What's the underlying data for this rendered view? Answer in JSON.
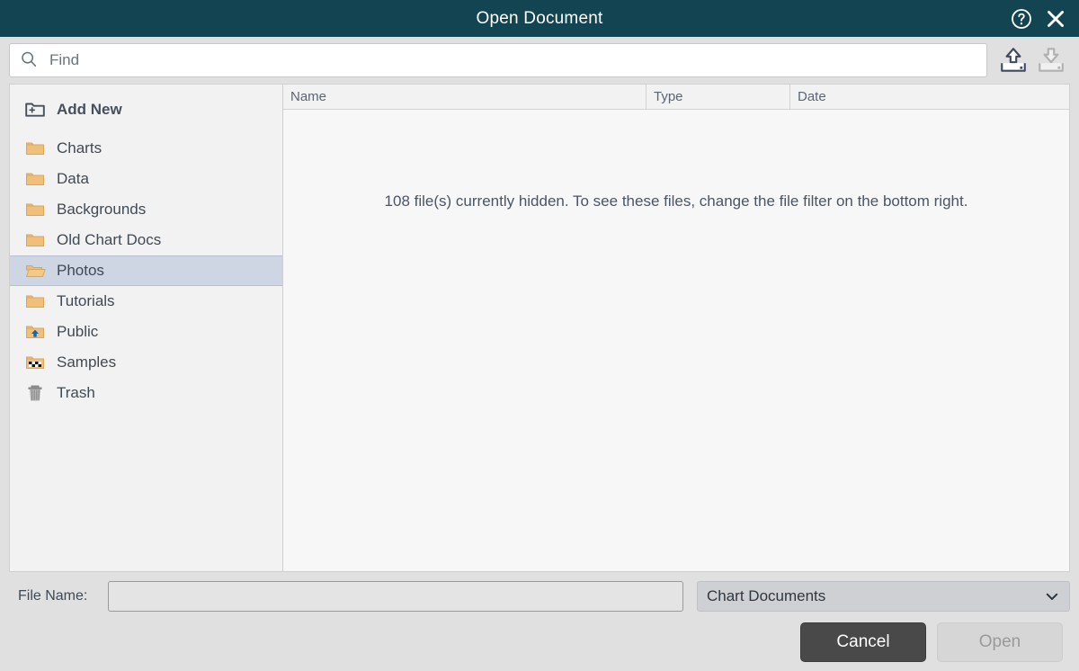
{
  "window": {
    "title": "Open Document",
    "help_icon": "help-circle-icon",
    "close_icon": "close-icon",
    "titlebar_color": "#124451"
  },
  "search": {
    "placeholder": "Find",
    "value": "",
    "icon": "search-icon",
    "upload_icon": "upload-tray-icon",
    "download_icon": "download-tray-icon"
  },
  "sidebar": {
    "add_new": {
      "label": "Add New",
      "icon": "folder-plus-icon"
    },
    "items": [
      {
        "label": "Charts",
        "icon": "folder-icon",
        "selected": false
      },
      {
        "label": "Data",
        "icon": "folder-icon",
        "selected": false
      },
      {
        "label": "Backgrounds",
        "icon": "folder-icon",
        "selected": false
      },
      {
        "label": "Old Chart Docs",
        "icon": "folder-icon",
        "selected": false
      },
      {
        "label": "Photos",
        "icon": "folder-open-icon",
        "selected": true
      },
      {
        "label": "Tutorials",
        "icon": "folder-icon",
        "selected": false
      },
      {
        "label": "Public",
        "icon": "folder-public-icon",
        "selected": false
      },
      {
        "label": "Samples",
        "icon": "folder-samples-icon",
        "selected": false
      },
      {
        "label": "Trash",
        "icon": "trash-icon",
        "selected": false
      }
    ],
    "selection_color": "#ced5e3"
  },
  "filelist": {
    "columns": [
      {
        "label": "Name"
      },
      {
        "label": "Type"
      },
      {
        "label": "Date"
      }
    ],
    "rows": [],
    "empty_message": "108 file(s) currently hidden. To see these files, change the file filter on the bottom right."
  },
  "footer": {
    "filename_label": "File Name:",
    "filename_value": "",
    "filename_placeholder": "",
    "filter_value": "Chart Documents",
    "filter_icon": "chevron-down-icon",
    "cancel_label": "Cancel",
    "open_label": "Open"
  }
}
